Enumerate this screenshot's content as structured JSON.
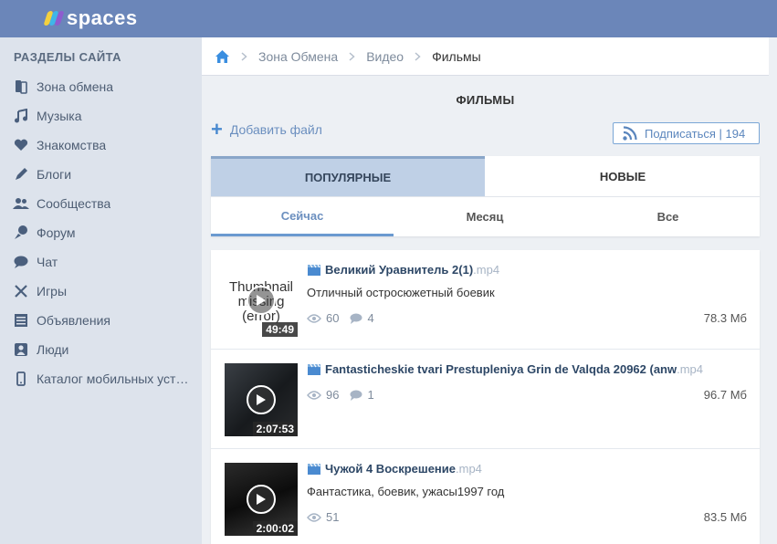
{
  "header": {
    "logo_text": "spaces",
    "logo_colors": [
      "#f4d03f",
      "#3fb6e8",
      "#8e5ccf"
    ]
  },
  "sidebar": {
    "title": "РАЗДЕЛЫ САЙТА",
    "icon_color": "#4a5f7d",
    "items": [
      {
        "label": "Зона обмена",
        "icon": "exchange-icon"
      },
      {
        "label": "Музыка",
        "icon": "music-icon"
      },
      {
        "label": "Знакомства",
        "icon": "heart-icon"
      },
      {
        "label": "Блоги",
        "icon": "pen-icon"
      },
      {
        "label": "Сообщества",
        "icon": "community-icon"
      },
      {
        "label": "Форум",
        "icon": "forum-icon"
      },
      {
        "label": "Чат",
        "icon": "chat-icon"
      },
      {
        "label": "Игры",
        "icon": "games-icon"
      },
      {
        "label": "Объявления",
        "icon": "ads-icon"
      },
      {
        "label": "Люди",
        "icon": "people-icon"
      },
      {
        "label": "Каталог мобильных устройств",
        "icon": "mobile-icon"
      }
    ]
  },
  "breadcrumb": {
    "items": [
      "Зона Обмена",
      "Видео",
      "Фильмы"
    ]
  },
  "page": {
    "title": "ФИЛЬМЫ",
    "add_file": "Добавить файл",
    "subscribe": "Подписаться | 194"
  },
  "tabs": {
    "main": [
      "ПОПУЛЯРНЫЕ",
      "НОВЫЕ"
    ],
    "sub": [
      "Сейчас",
      "Месяц",
      "Все"
    ]
  },
  "files": [
    {
      "title": "Великий Уравнитель 2(1)",
      "ext": ".mp4",
      "description": "Отличный остросюжетный боевик",
      "views": "60",
      "comments": "4",
      "size": "78.3 Мб",
      "duration": "49:49",
      "thumb_alt": "Thumbnail missing (error)"
    },
    {
      "title": "Fantasticheskie tvari Prestupleniya Grin de Valqda 20962 (anw",
      "ext": ".mp4",
      "description": "",
      "views": "96",
      "comments": "1",
      "size": "96.7 Мб",
      "duration": "2:07:53"
    },
    {
      "title": "Чужой 4 Воскрешение",
      "ext": ".mp4",
      "description": "Фантастика, боевик, ужасы1997 год",
      "views": "51",
      "comments": "",
      "size": "83.5 Мб",
      "duration": "2:00:02"
    }
  ],
  "colors": {
    "header_bg": "#6b86b9",
    "accent": "#6b8fbf",
    "sidebar_bg": "#dde3ec"
  }
}
